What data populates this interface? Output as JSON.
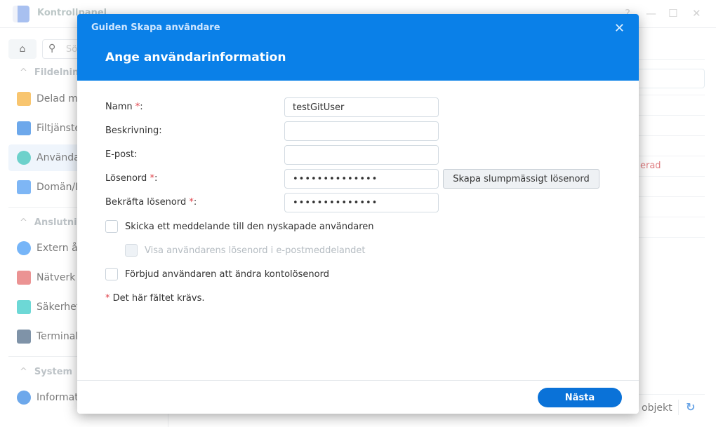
{
  "app": {
    "title": "Kontrollpanel",
    "window_controls": [
      "?",
      "—",
      "☐",
      "✕"
    ],
    "search_placeholder": "Sök",
    "sidebar": {
      "groups": [
        {
          "label": "Fildelning",
          "items": [
            "Delad mapp",
            "Filtjänster",
            "Användare",
            "Domän/LDAP"
          ]
        },
        {
          "label": "Anslutning",
          "items": [
            "Extern åtkomst",
            "Nätverk",
            "Säkerhet",
            "Terminal"
          ]
        },
        {
          "label": "System",
          "items": [
            "Information"
          ]
        }
      ],
      "active_item": "Användare"
    },
    "background": {
      "status_text": "erad",
      "footer_count_label": "objekt"
    }
  },
  "modal": {
    "wizard_title": "Guiden Skapa användare",
    "step_title": "Ange användarinformation",
    "close_icon": "close-icon",
    "fields": [
      {
        "label": "Namn",
        "required": true,
        "value": "testGitUser",
        "type": "text"
      },
      {
        "label": "Beskrivning",
        "required": false,
        "value": "",
        "type": "text"
      },
      {
        "label": "E-post",
        "required": false,
        "value": "",
        "type": "text"
      },
      {
        "label": "Lösenord",
        "required": true,
        "value": "••••••••••••••",
        "type": "password"
      },
      {
        "label": "Bekräfta lösenord",
        "required": true,
        "value": "••••••••••••••",
        "type": "password"
      }
    ],
    "generate_password_label": "Skapa slumpmässigt lösenord",
    "checkboxes": [
      {
        "label": "Skicka ett meddelande till den nyskapade användaren",
        "checked": false,
        "disabled": false
      },
      {
        "label": "Visa användarens lösenord i e-postmeddelandet",
        "checked": false,
        "disabled": true
      },
      {
        "label": "Förbjud användaren att ändra kontolösenord",
        "checked": false,
        "disabled": false
      }
    ],
    "required_note": "Det här fältet krävs.",
    "required_marker": "*",
    "next_label": "Nästa"
  }
}
